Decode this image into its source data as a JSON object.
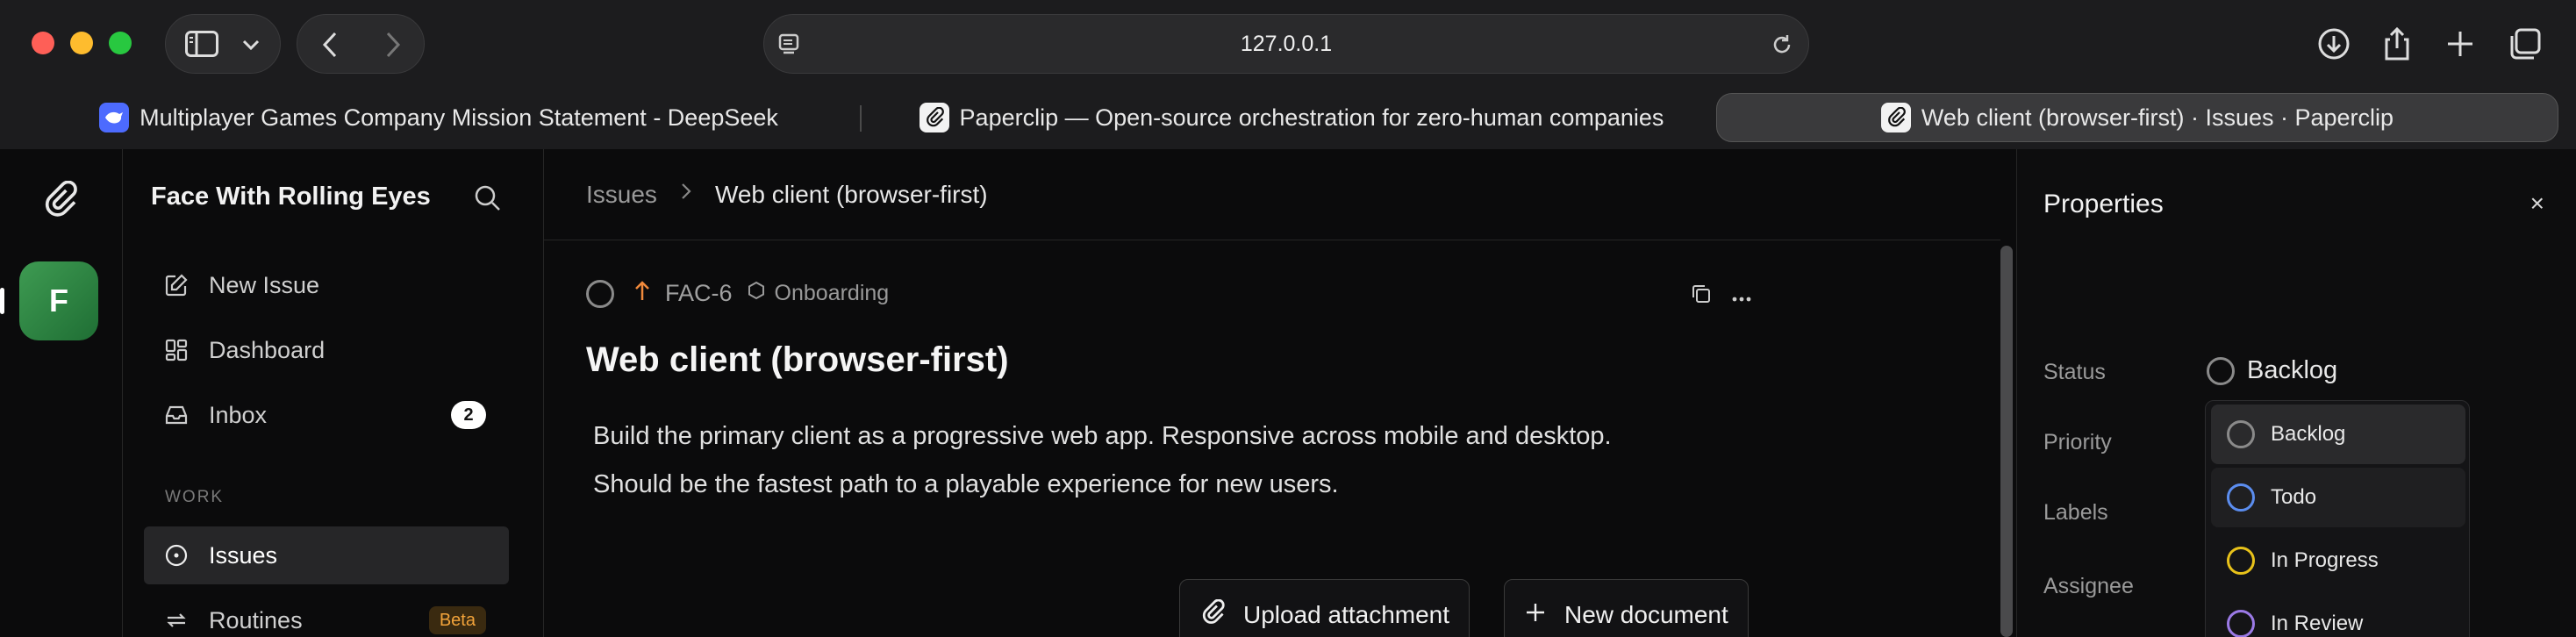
{
  "browser": {
    "url": "127.0.0.1",
    "tabs": [
      {
        "label": "Multiplayer Games Company Mission Statement - DeepSeek"
      },
      {
        "label": "Paperclip — Open-source orchestration for zero-human companies"
      },
      {
        "label": "Web client (browser-first) · Issues · Paperclip"
      }
    ]
  },
  "rail": {
    "avatar_letter": "F"
  },
  "sidebar": {
    "company": "Face With Rolling Eyes",
    "items": [
      {
        "label": "New Issue",
        "icon": "edit-icon"
      },
      {
        "label": "Dashboard",
        "icon": "dashboard-icon"
      },
      {
        "label": "Inbox",
        "icon": "inbox-icon",
        "badge": "2"
      },
      {
        "label": "Issues",
        "icon": "issues-icon"
      },
      {
        "label": "Routines",
        "icon": "routines-icon",
        "tag": "Beta"
      }
    ],
    "section_work": "WORK"
  },
  "breadcrumb": {
    "parent": "Issues",
    "current": "Web client (browser-first)"
  },
  "issue": {
    "id": "FAC-6",
    "project": "Onboarding",
    "title": "Web client (browser-first)",
    "description_line1": "Build the primary client as a progressive web app. Responsive across mobile and desktop.",
    "description_line2": "Should be the fastest path to a playable experience for new users."
  },
  "actions": {
    "upload": "Upload attachment",
    "new_doc": "New document"
  },
  "properties": {
    "title": "Properties",
    "close": "×",
    "labels": {
      "status": "Status",
      "priority": "Priority",
      "labels": "Labels",
      "assignee": "Assignee"
    },
    "status_value": "Backlog",
    "status_options": [
      {
        "label": "Backlog",
        "color": "#8a8a8a"
      },
      {
        "label": "Todo",
        "color": "#5b8def"
      },
      {
        "label": "In Progress",
        "color": "#e8c21a"
      },
      {
        "label": "In Review",
        "color": "#9b7ae6"
      }
    ]
  },
  "colors": {
    "priority_arrow": "#f08a3c",
    "beta_text": "#f2a33a"
  }
}
